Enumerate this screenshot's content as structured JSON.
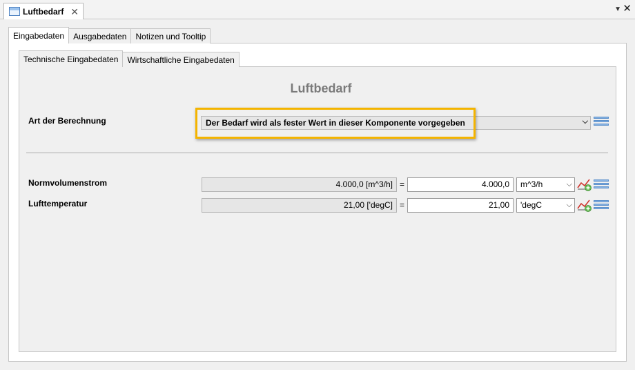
{
  "editor": {
    "tab_title": "Luftbedarf"
  },
  "outer_tabs": [
    "Eingabedaten",
    "Ausgabedaten",
    "Notizen und Tooltip"
  ],
  "inner_tabs": [
    "Technische Eingabedaten",
    "Wirtschaftliche Eingabedaten"
  ],
  "section": {
    "title": "Luftbedarf"
  },
  "calculation": {
    "label": "Art der Berechnung",
    "selected": "Der Bedarf wird als fester Wert in dieser Komponente vorgegeben"
  },
  "rows": [
    {
      "label": "Normvolumenstrom",
      "readonly_value": "4.000,0 [m^3/h]",
      "equals": "=",
      "value": "4.000,0",
      "unit": "m^3/h"
    },
    {
      "label": "Lufttemperatur",
      "readonly_value": "21,00 ['degC]",
      "equals": "=",
      "value": "21,00",
      "unit": "'degC"
    }
  ],
  "icons": {
    "editor_tab": "document-icon",
    "list": "list-icon",
    "chart": "chart-add-icon"
  },
  "colors": {
    "highlight": "#f4b400",
    "accent": "#5a8fcb"
  }
}
